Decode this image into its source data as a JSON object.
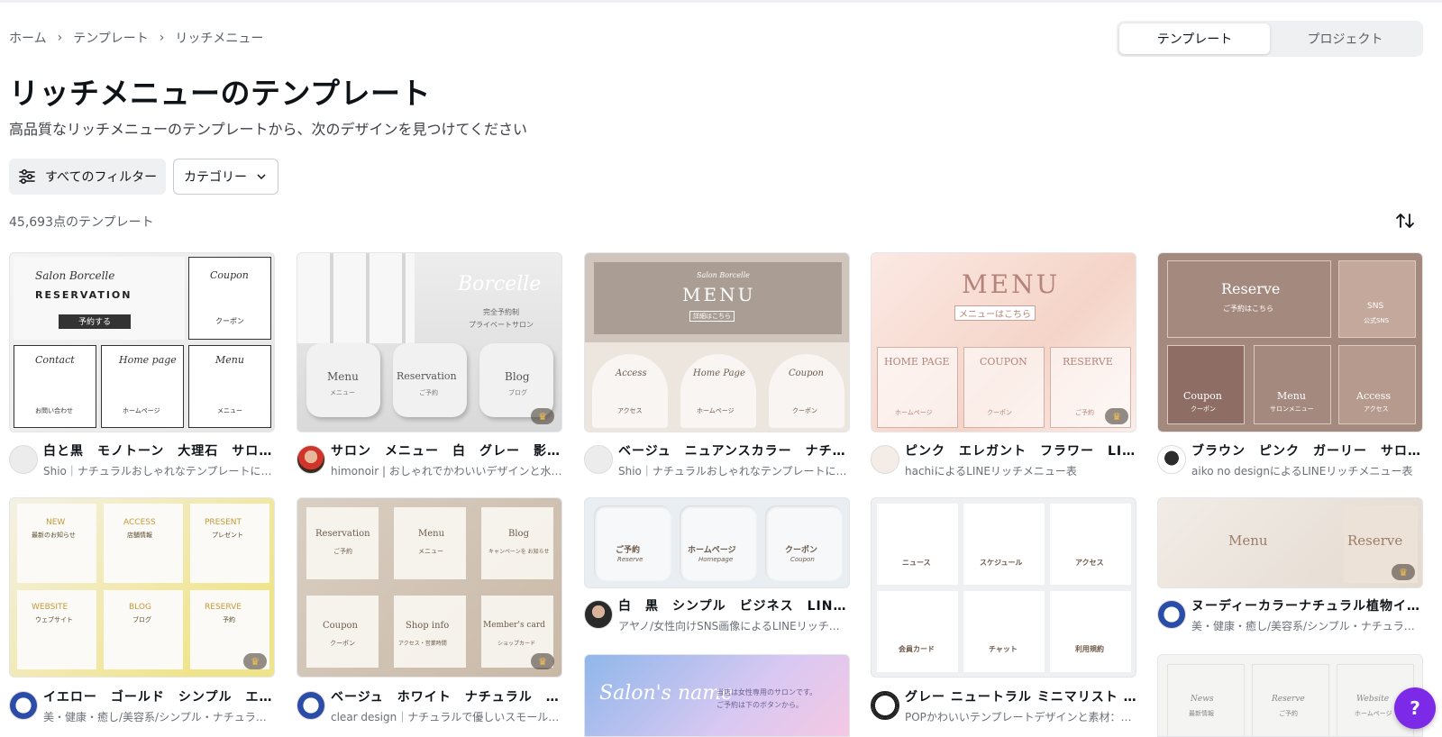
{
  "breadcrumb": {
    "home": "ホーム",
    "templates": "テンプレート",
    "current": "リッチメニュー"
  },
  "switcher": {
    "templates": "テンプレート",
    "projects": "プロジェクト"
  },
  "page": {
    "title": "リッチメニューのテンプレート",
    "subtitle": "高品質なリッチメニューのテンプレートから、次のデザインを見つけてください",
    "count": "45,693点のテンプレート"
  },
  "filters": {
    "all_filters": "すべてのフィルター",
    "category": "カテゴリー"
  },
  "icons": {
    "filter": "sliders-icon",
    "chevron": "chevron-down-icon",
    "sort": "sort-icon",
    "crown": "crown-icon",
    "help": "help-icon"
  },
  "colors": {
    "accent": "#7d2ae8",
    "segment_bg": "#eef0f2"
  },
  "help_label": "?",
  "cards": [
    {
      "title": "白と黒　モノトーン　大理石　サロン…",
      "author": "Shio｜ナチュラルおしゃれなテンプレートに…",
      "thumb": {
        "t1": "Salon Borcelle",
        "t2": "RESERVATION",
        "t3": "予約する",
        "t4": "Coupon",
        "t5": "クーポン",
        "t6": "Contact",
        "t7": "お問い合わせ",
        "t8": "Home page",
        "t9": "ホームページ",
        "t10": "Menu",
        "t11": "メニュー"
      }
    },
    {
      "title": "サロン　メニュー　白　グレー　影　…",
      "author": "himonoir | おしゃれでかわいいデザインと水…",
      "thumb": {
        "t1": "Borcelle",
        "t2": "完全予約制",
        "t3": "プライベートサロン",
        "t4": "Menu",
        "t5": "メニュー",
        "t6": "Reservation",
        "t7": "ご予約",
        "t8": "Blog",
        "t9": "ブログ"
      }
    },
    {
      "title": "ベージュ　ニュアンスカラー　ナチュ…",
      "author": "Shio｜ナチュラルおしゃれなテンプレートに…",
      "thumb": {
        "t1": "Salon Borcelle",
        "t2": "MENU",
        "t3": "詳細はこちら",
        "t4": "Access",
        "t5": "アクセス",
        "t6": "Home Page",
        "t7": "ホームページ",
        "t8": "Coupon",
        "t9": "クーポン"
      }
    },
    {
      "title": "ピンク　エレガント　フラワー　LINE…",
      "author": "hachiによるLINEリッチメニュー表",
      "thumb": {
        "t1": "MENU",
        "t2": "メニューはこちら",
        "t3": "HOME PAGE",
        "t4": "ホームページ",
        "t5": "COUPON",
        "t6": "クーポン",
        "t7": "RESERVE",
        "t8": "ご予約"
      }
    },
    {
      "title": "ブラウン　ピンク　ガーリー　サロン…",
      "author": "aiko no designによるLINEリッチメニュー表",
      "thumb": {
        "t1": "Reserve",
        "t2": "ご予約はこちら",
        "t3": "SNS",
        "t4": "公式SNS",
        "t5": "Coupon",
        "t6": "クーポン",
        "t7": "Menu",
        "t8": "サロンメニュー",
        "t9": "Access",
        "t10": "アクセス"
      }
    },
    {
      "title": "イエロー　ゴールド　シンプル　エレ…",
      "author": "美・健康・癒し/美容系/シンプル・ナチュラル…",
      "thumb": {
        "t1": "NEW",
        "t2": "最新のお知らせ",
        "t3": "ACCESS",
        "t4": "店舗情報",
        "t5": "PRESENT",
        "t6": "プレゼント",
        "t7": "WEBSITE",
        "t8": "ウェブサイト",
        "t9": "BLOG",
        "t10": "ブログ",
        "t11": "RESERVE",
        "t12": "予約"
      }
    },
    {
      "title": "ベージュ　ホワイト　ナチュラル　押…",
      "author": "clear design｜ナチュラルで優しいスモールビ…",
      "thumb": {
        "t1": "Reservation",
        "t2": "ご予約",
        "t3": "Menu",
        "t4": "メニュー",
        "t5": "Blog",
        "t6": "キャンペーンを お知らせ",
        "t7": "Coupon",
        "t8": "クーポン",
        "t9": "Shop info",
        "t10": "アクセス・営業時間",
        "t11": "Member's card",
        "t12": "ショップカード"
      }
    },
    {
      "title": "白　黒　シンプル　ビジネス　LINEリ…",
      "author": "アヤノ/女性向けSNS画像によるLINEリッチメ…",
      "thumb": {
        "t1": "ご予約",
        "t2": "Reserve",
        "t3": "ホームページ",
        "t4": "Homepage",
        "t5": "クーポン",
        "t6": "Coupon"
      }
    },
    {
      "title": "グレー ニュートラル ミニマリスト シン…",
      "author": "POPかわいいテンプレートデザインと素材：…",
      "thumb": {
        "t1": "ニュース",
        "t2": "スケジュール",
        "t3": "アクセス",
        "t4": "会員カード",
        "t5": "チャット",
        "t6": "利用規約"
      }
    },
    {
      "title": "ヌーディーカラーナチュラル植物イラ…",
      "author": "美・健康・癒し/美容系/シンプル・ナチュラル…",
      "thumb": {
        "t1": "Menu",
        "t2": "Reserve"
      }
    }
  ],
  "partial_cards": {
    "salon": {
      "t1": "Salon's name",
      "t2": "当店は女性専用のサロンです。",
      "t3": "ご予約は下のボタンから。"
    },
    "floral": {
      "t1": "News",
      "t2": "最新情報",
      "t3": "Reserve",
      "t4": "ご予約",
      "t5": "Website",
      "t6": "ホームページ"
    }
  }
}
